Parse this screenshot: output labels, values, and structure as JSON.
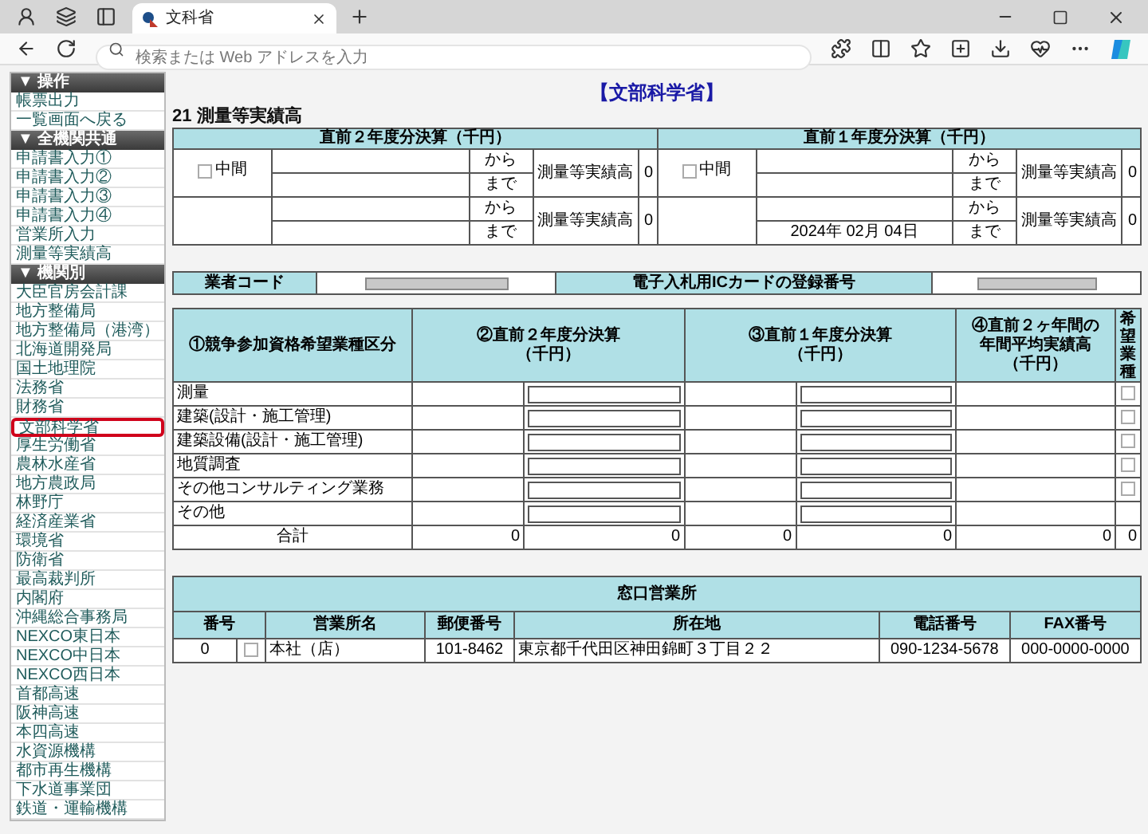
{
  "browser": {
    "tab_title": "文科省",
    "address_placeholder": "検索または Web アドレスを入力"
  },
  "sidebar": {
    "sections": [
      {
        "title": "▼ 操作",
        "items": [
          {
            "label": "帳票出力",
            "selected": false
          },
          {
            "label": "一覧画面へ戻る",
            "selected": false
          }
        ]
      },
      {
        "title": "▼ 全機関共通",
        "items": [
          {
            "label": "申請書入力①",
            "selected": false
          },
          {
            "label": "申請書入力②",
            "selected": false
          },
          {
            "label": "申請書入力③",
            "selected": false
          },
          {
            "label": "申請書入力④",
            "selected": false
          },
          {
            "label": "営業所入力",
            "selected": false
          },
          {
            "label": "測量等実績高",
            "selected": false
          }
        ]
      },
      {
        "title": "▼ 機関別",
        "items": [
          {
            "label": "大臣官房会計課",
            "selected": false
          },
          {
            "label": "地方整備局",
            "selected": false
          },
          {
            "label": "地方整備局（港湾）",
            "selected": false
          },
          {
            "label": "北海道開発局",
            "selected": false
          },
          {
            "label": "国土地理院",
            "selected": false
          },
          {
            "label": "法務省",
            "selected": false
          },
          {
            "label": "財務省",
            "selected": false
          },
          {
            "label": "文部科学省",
            "selected": true
          },
          {
            "label": "厚生労働省",
            "selected": false
          },
          {
            "label": "農林水産省",
            "selected": false
          },
          {
            "label": "地方農政局",
            "selected": false
          },
          {
            "label": "林野庁",
            "selected": false
          },
          {
            "label": "経済産業省",
            "selected": false
          },
          {
            "label": "環境省",
            "selected": false
          },
          {
            "label": "防衛省",
            "selected": false
          },
          {
            "label": "最高裁判所",
            "selected": false
          },
          {
            "label": "内閣府",
            "selected": false
          },
          {
            "label": "沖縄総合事務局",
            "selected": false
          },
          {
            "label": "NEXCO東日本",
            "selected": false
          },
          {
            "label": "NEXCO中日本",
            "selected": false
          },
          {
            "label": "NEXCO西日本",
            "selected": false
          },
          {
            "label": "首都高速",
            "selected": false
          },
          {
            "label": "阪神高速",
            "selected": false
          },
          {
            "label": "本四高速",
            "selected": false
          },
          {
            "label": "水資源機構",
            "selected": false
          },
          {
            "label": "都市再生機構",
            "selected": false
          },
          {
            "label": "下水道事業団",
            "selected": false
          },
          {
            "label": "鉄道・運輸機構",
            "selected": false
          }
        ]
      }
    ]
  },
  "page": {
    "heading": "【文部科学省】",
    "section_title": "21 測量等実績高"
  },
  "periods": [
    {
      "header": "直前２年度分決算（千円）",
      "rows": [
        {
          "checkbox_label": "中間",
          "checked": false,
          "from": "から",
          "to": "まで",
          "result_label": "測量等実績高",
          "result": "0"
        },
        {
          "from": "から",
          "to": "まで",
          "result_label": "測量等実績高",
          "result": "0"
        }
      ]
    },
    {
      "header": "直前１年度分決算（千円）",
      "rows": [
        {
          "checkbox_label": "中間",
          "checked": false,
          "from": "から",
          "to": "まで",
          "result_label": "測量等実績高",
          "result": "0"
        },
        {
          "from": "から",
          "to": "まで",
          "to_date": "2024年 02月 04日",
          "result_label": "測量等実績高",
          "result": "0"
        }
      ]
    }
  ],
  "ids": {
    "vendor_code_label": "業者コード",
    "ic_card_label": "電子入札用ICカードの登録番号"
  },
  "results": {
    "columns": [
      [
        "①競争参加資格希望業種区分"
      ],
      [
        "②直前２年度分決算",
        "（千円）"
      ],
      [
        "③直前１年度分決算",
        "（千円）"
      ],
      [
        "④直前２ヶ年間の",
        "年間平均実績高",
        "（千円）"
      ],
      [
        "希望業種"
      ]
    ],
    "rows": [
      {
        "category": "測量",
        "kind": "check",
        "checked": false
      },
      {
        "category": "建築(設計・施工管理)",
        "kind": "check",
        "checked": false
      },
      {
        "category": "建築設備(設計・施工管理)",
        "kind": "check",
        "checked": false
      },
      {
        "category": "地質調査",
        "kind": "check",
        "checked": false
      },
      {
        "category": "その他コンサルティング業務",
        "kind": "check",
        "checked": false
      },
      {
        "category": "その他",
        "kind": "plain"
      }
    ],
    "total": {
      "label": "合計",
      "values": [
        "0",
        "0",
        "0",
        "0",
        "0",
        "0"
      ]
    }
  },
  "offices": {
    "title": "窓口営業所",
    "columns": [
      "番号",
      "営業所名",
      "郵便番号",
      "所在地",
      "電話番号",
      "FAX番号"
    ],
    "rows": [
      {
        "no": "0",
        "checked": false,
        "name": "本社（店）",
        "postal": "101-8462",
        "address": "東京都千代田区神田錦町３丁目２２",
        "phone": "090-1234-5678",
        "fax": "000-0000-0000"
      }
    ]
  }
}
